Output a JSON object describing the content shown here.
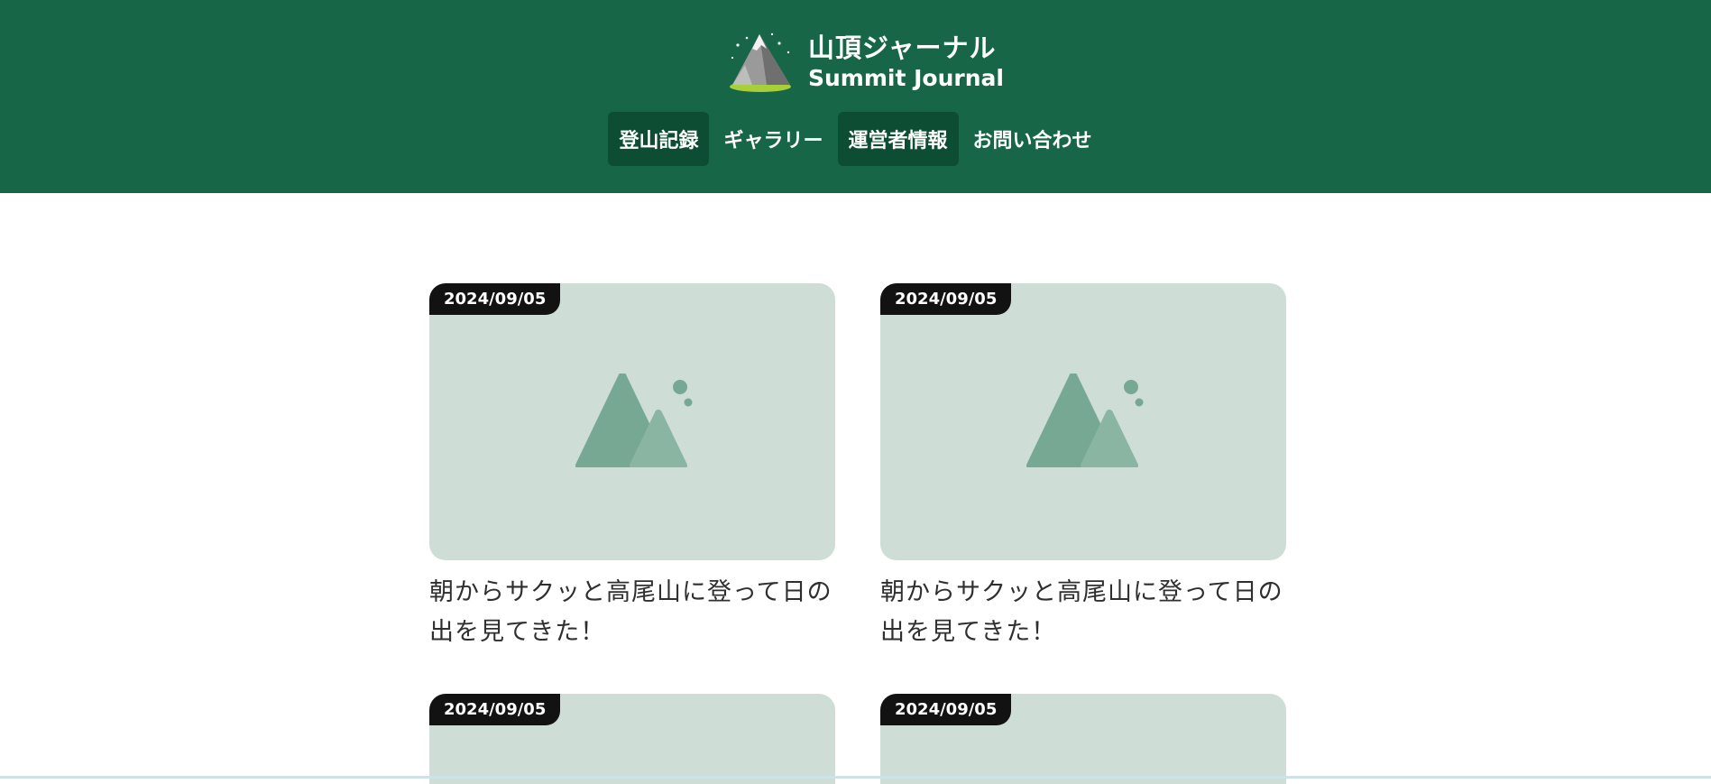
{
  "site": {
    "title_ja": "山頂ジャーナル",
    "title_en": "Summit Journal",
    "logo_icon": "mountain-logo-icon"
  },
  "nav": {
    "items": [
      {
        "label": "登山記録",
        "active": true
      },
      {
        "label": "ギャラリー",
        "active": false
      },
      {
        "label": "運営者情報",
        "active": true
      },
      {
        "label": "お問い合わせ",
        "active": false
      }
    ]
  },
  "posts": [
    {
      "date": "2024/09/05",
      "title": "朝からサクッと高尾山に登って日の出を見てきた！",
      "thumbnail_icon": "image-placeholder-icon"
    },
    {
      "date": "2024/09/05",
      "title": "朝からサクッと高尾山に登って日の出を見てきた！",
      "thumbnail_icon": "image-placeholder-icon"
    },
    {
      "date": "2024/09/05"
    },
    {
      "date": "2024/09/05"
    }
  ],
  "colors": {
    "header_bg": "#166647",
    "nav_active_bg": "#0d4d34",
    "thumb_bg": "#cfddd7",
    "badge_bg": "#121212",
    "icon_mountain": "#76a893"
  }
}
